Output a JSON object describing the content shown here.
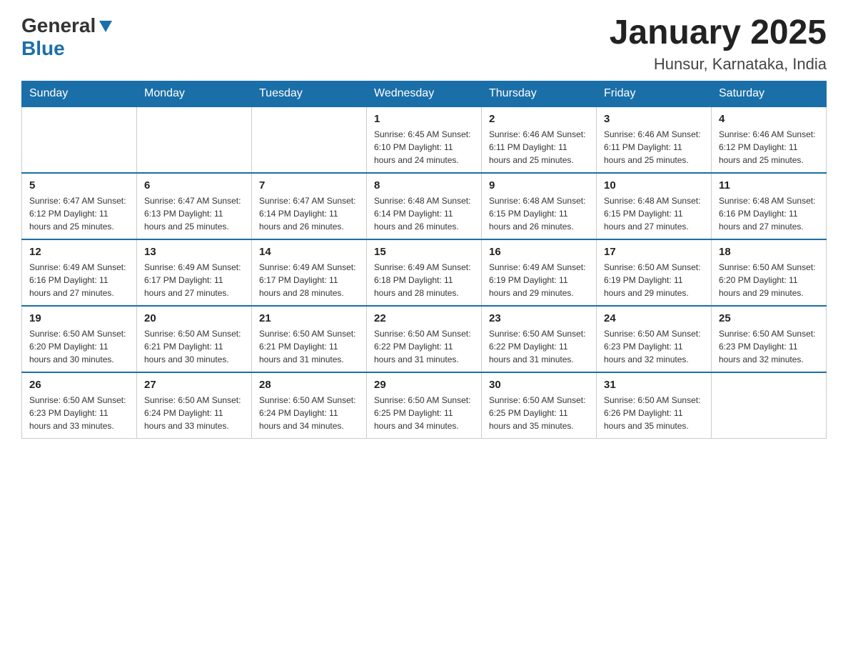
{
  "logo": {
    "text_general": "General",
    "text_blue": "Blue"
  },
  "title": "January 2025",
  "subtitle": "Hunsur, Karnataka, India",
  "days_of_week": [
    "Sunday",
    "Monday",
    "Tuesday",
    "Wednesday",
    "Thursday",
    "Friday",
    "Saturday"
  ],
  "weeks": [
    [
      {
        "day": "",
        "info": ""
      },
      {
        "day": "",
        "info": ""
      },
      {
        "day": "",
        "info": ""
      },
      {
        "day": "1",
        "info": "Sunrise: 6:45 AM\nSunset: 6:10 PM\nDaylight: 11 hours and 24 minutes."
      },
      {
        "day": "2",
        "info": "Sunrise: 6:46 AM\nSunset: 6:11 PM\nDaylight: 11 hours and 25 minutes."
      },
      {
        "day": "3",
        "info": "Sunrise: 6:46 AM\nSunset: 6:11 PM\nDaylight: 11 hours and 25 minutes."
      },
      {
        "day": "4",
        "info": "Sunrise: 6:46 AM\nSunset: 6:12 PM\nDaylight: 11 hours and 25 minutes."
      }
    ],
    [
      {
        "day": "5",
        "info": "Sunrise: 6:47 AM\nSunset: 6:12 PM\nDaylight: 11 hours and 25 minutes."
      },
      {
        "day": "6",
        "info": "Sunrise: 6:47 AM\nSunset: 6:13 PM\nDaylight: 11 hours and 25 minutes."
      },
      {
        "day": "7",
        "info": "Sunrise: 6:47 AM\nSunset: 6:14 PM\nDaylight: 11 hours and 26 minutes."
      },
      {
        "day": "8",
        "info": "Sunrise: 6:48 AM\nSunset: 6:14 PM\nDaylight: 11 hours and 26 minutes."
      },
      {
        "day": "9",
        "info": "Sunrise: 6:48 AM\nSunset: 6:15 PM\nDaylight: 11 hours and 26 minutes."
      },
      {
        "day": "10",
        "info": "Sunrise: 6:48 AM\nSunset: 6:15 PM\nDaylight: 11 hours and 27 minutes."
      },
      {
        "day": "11",
        "info": "Sunrise: 6:48 AM\nSunset: 6:16 PM\nDaylight: 11 hours and 27 minutes."
      }
    ],
    [
      {
        "day": "12",
        "info": "Sunrise: 6:49 AM\nSunset: 6:16 PM\nDaylight: 11 hours and 27 minutes."
      },
      {
        "day": "13",
        "info": "Sunrise: 6:49 AM\nSunset: 6:17 PM\nDaylight: 11 hours and 27 minutes."
      },
      {
        "day": "14",
        "info": "Sunrise: 6:49 AM\nSunset: 6:17 PM\nDaylight: 11 hours and 28 minutes."
      },
      {
        "day": "15",
        "info": "Sunrise: 6:49 AM\nSunset: 6:18 PM\nDaylight: 11 hours and 28 minutes."
      },
      {
        "day": "16",
        "info": "Sunrise: 6:49 AM\nSunset: 6:19 PM\nDaylight: 11 hours and 29 minutes."
      },
      {
        "day": "17",
        "info": "Sunrise: 6:50 AM\nSunset: 6:19 PM\nDaylight: 11 hours and 29 minutes."
      },
      {
        "day": "18",
        "info": "Sunrise: 6:50 AM\nSunset: 6:20 PM\nDaylight: 11 hours and 29 minutes."
      }
    ],
    [
      {
        "day": "19",
        "info": "Sunrise: 6:50 AM\nSunset: 6:20 PM\nDaylight: 11 hours and 30 minutes."
      },
      {
        "day": "20",
        "info": "Sunrise: 6:50 AM\nSunset: 6:21 PM\nDaylight: 11 hours and 30 minutes."
      },
      {
        "day": "21",
        "info": "Sunrise: 6:50 AM\nSunset: 6:21 PM\nDaylight: 11 hours and 31 minutes."
      },
      {
        "day": "22",
        "info": "Sunrise: 6:50 AM\nSunset: 6:22 PM\nDaylight: 11 hours and 31 minutes."
      },
      {
        "day": "23",
        "info": "Sunrise: 6:50 AM\nSunset: 6:22 PM\nDaylight: 11 hours and 31 minutes."
      },
      {
        "day": "24",
        "info": "Sunrise: 6:50 AM\nSunset: 6:23 PM\nDaylight: 11 hours and 32 minutes."
      },
      {
        "day": "25",
        "info": "Sunrise: 6:50 AM\nSunset: 6:23 PM\nDaylight: 11 hours and 32 minutes."
      }
    ],
    [
      {
        "day": "26",
        "info": "Sunrise: 6:50 AM\nSunset: 6:23 PM\nDaylight: 11 hours and 33 minutes."
      },
      {
        "day": "27",
        "info": "Sunrise: 6:50 AM\nSunset: 6:24 PM\nDaylight: 11 hours and 33 minutes."
      },
      {
        "day": "28",
        "info": "Sunrise: 6:50 AM\nSunset: 6:24 PM\nDaylight: 11 hours and 34 minutes."
      },
      {
        "day": "29",
        "info": "Sunrise: 6:50 AM\nSunset: 6:25 PM\nDaylight: 11 hours and 34 minutes."
      },
      {
        "day": "30",
        "info": "Sunrise: 6:50 AM\nSunset: 6:25 PM\nDaylight: 11 hours and 35 minutes."
      },
      {
        "day": "31",
        "info": "Sunrise: 6:50 AM\nSunset: 6:26 PM\nDaylight: 11 hours and 35 minutes."
      },
      {
        "day": "",
        "info": ""
      }
    ]
  ]
}
